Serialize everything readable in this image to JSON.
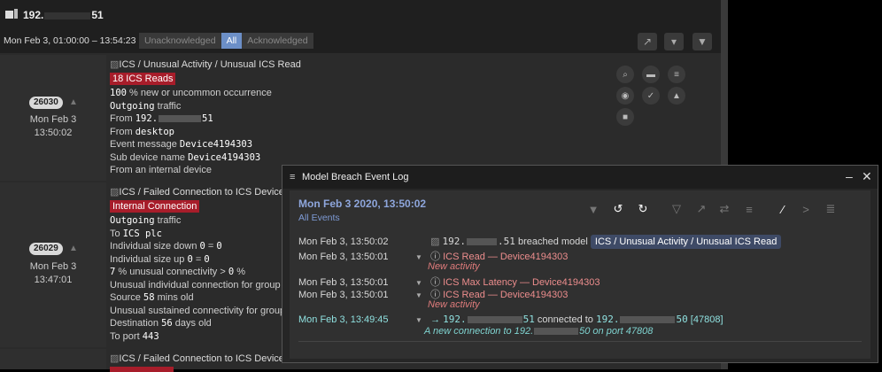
{
  "header": {
    "device_label": "192.",
    "device_label_end": "51",
    "time_range": "Mon Feb 3, 01:00:00 – 13:54:23",
    "filters": [
      "Unacknowledged",
      "All",
      "Acknowledged"
    ],
    "active_filter": "All",
    "tool_icons": [
      "chart-icon",
      "collapse-icon",
      "filter-icon"
    ]
  },
  "events": [
    {
      "id": "26030",
      "date": "Mon Feb 3",
      "time": "13:50:02",
      "model_path": "ICS / Unusual Activity / Unusual ICS Read",
      "tag": "18 ICS Reads",
      "lines": [
        {
          "value": "100",
          "text": " % new or uncommon occurrence"
        },
        {
          "value": "Outgoing",
          "text": " traffic"
        },
        {
          "text": "From ",
          "value": "192.",
          "value_end": "51"
        },
        {
          "text": "From ",
          "value": "desktop"
        },
        {
          "text": "Event message ",
          "value": "Device4194303"
        },
        {
          "text": "Sub device name ",
          "value": "Device4194303"
        },
        {
          "text": "From an internal device"
        }
      ]
    },
    {
      "id": "26029",
      "date": "Mon Feb 3",
      "time": "13:47:01",
      "model_path": "ICS / Failed Connection to ICS Device",
      "tag": "Internal Connection",
      "lines": [
        {
          "value": "Outgoing",
          "text": " traffic"
        },
        {
          "text": "To ",
          "value": "ICS plc"
        },
        {
          "text": "Individual size down ",
          "value": "0",
          "text2": " = ",
          "value2": "0"
        },
        {
          "text": "Individual size up ",
          "value": "0",
          "text2": " = ",
          "value2": "0"
        },
        {
          "value": "7",
          "text": " % unusual connectivity > ",
          "value2": "0",
          "text2": " %"
        },
        {
          "text": "Unusual individual connection for group"
        },
        {
          "text": "Source ",
          "value": "58",
          "text2": " mins old"
        },
        {
          "text": "Unusual sustained connectivity for group"
        },
        {
          "text": "Destination ",
          "value": "56",
          "text2": " days old"
        },
        {
          "text": "To port ",
          "value": "443"
        }
      ]
    },
    {
      "model_path": "ICS / Failed Connection to ICS Device"
    }
  ],
  "modal": {
    "title": "Model Breach Event Log",
    "heading_date": "Mon Feb 3 2020, 13:50:02",
    "sub_link": "All Events",
    "rows": [
      {
        "time": "Mon Feb 3, 13:50:02",
        "ip": "192.",
        "ip_end": ".51",
        "text": " breached model ",
        "pill": "ICS / Unusual Activity / Unusual ICS Read"
      },
      {
        "time": "Mon Feb 3, 13:50:01",
        "event": "ICS Read — Device4194303",
        "sub": "New activity"
      },
      {
        "time": "Mon Feb 3, 13:50:01",
        "event": "ICS Max Latency — Device4194303"
      },
      {
        "time": "Mon Feb 3, 13:50:01",
        "event": "ICS Read — Device4194303",
        "sub": "New activity"
      },
      {
        "time": "Mon Feb 3, 13:49:45",
        "src": "192.",
        "src_end": "51",
        "mid": " connected to ",
        "dst": "192.",
        "dst_end": "50",
        "port": "[47808]",
        "sub_a": "A new connection to 192.",
        "sub_b": "50 on port 47808"
      }
    ]
  }
}
